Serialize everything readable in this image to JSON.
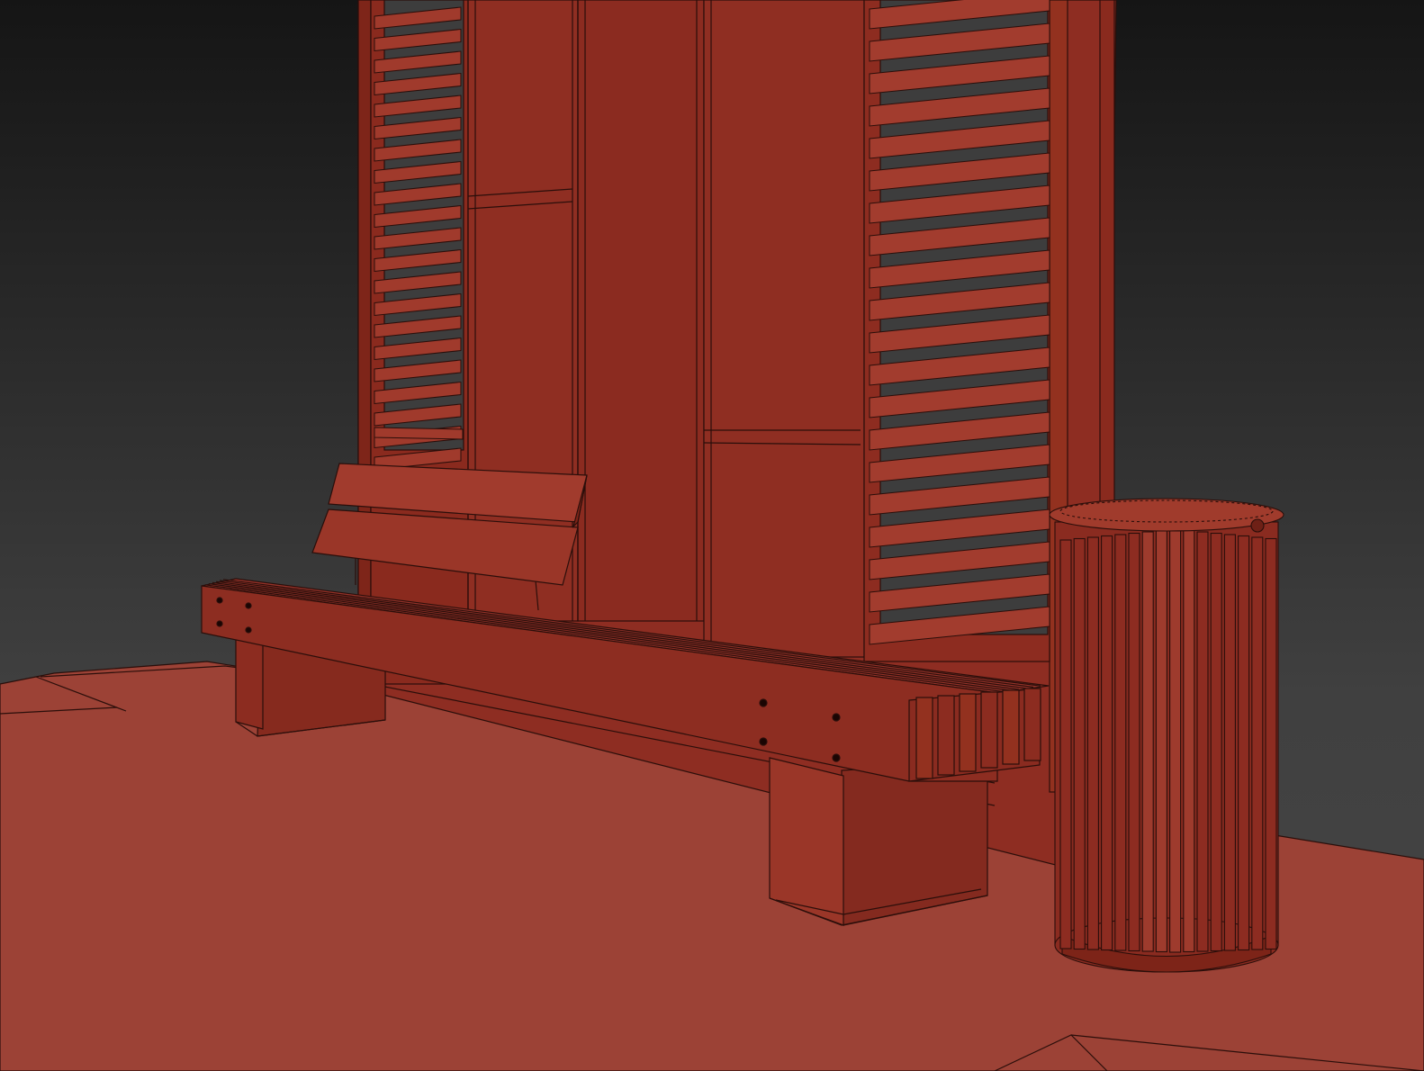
{
  "viewport": {
    "background_top": "#151515",
    "background_bottom": "#404040",
    "shaded_color": "#8e2d22",
    "highlight_color": "#9e3a2c",
    "floor_color": "#9c4236",
    "wire_color": "#2a0e0a"
  },
  "objects": [
    {
      "name": "shelter-wall"
    },
    {
      "name": "slatted-screen-left"
    },
    {
      "name": "slatted-screen-right"
    },
    {
      "name": "bench"
    },
    {
      "name": "trash-bin"
    },
    {
      "name": "ground-plane"
    }
  ]
}
